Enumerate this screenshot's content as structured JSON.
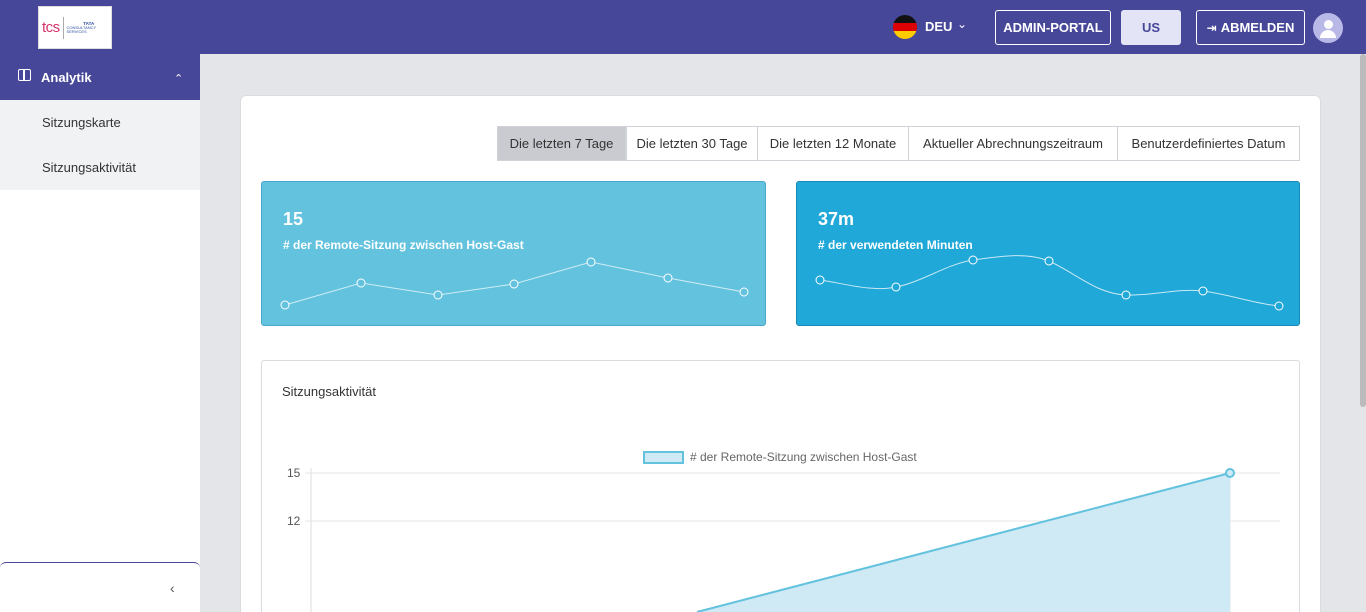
{
  "header": {
    "logo_brand": "tcs",
    "logo_tata": "TATA",
    "logo_consultancy": "CONSULTANCY SERVICES",
    "language": "DEU",
    "admin_portal_label": "ADMIN-PORTAL",
    "region_label": "US",
    "logout_label": "ABMELDEN"
  },
  "sidebar": {
    "section_label": "Analytik",
    "items": [
      {
        "label": "Sitzungskarte"
      },
      {
        "label": "Sitzungsaktivität"
      }
    ]
  },
  "filters": {
    "selected": "Die letzten 7 Tage",
    "options": [
      "Die letzten 7 Tage",
      "Die letzten 30 Tage",
      "Die letzten 12 Monate",
      "Aktueller Abrechnungszeitraum",
      "Benutzerdefiniertes Datum"
    ]
  },
  "tiles": [
    {
      "value": "15",
      "label": "# der Remote-Sitzung zwischen Host-Gast",
      "color": "#63c2de",
      "sparkline": [
        1,
        3,
        2,
        3,
        5,
        3.5,
        2
      ],
      "smooth": false
    },
    {
      "value": "37m",
      "label": "# der verwendeten Minuten",
      "color": "#20a8d8",
      "sparkline": [
        3,
        2.5,
        5,
        5,
        1,
        1.5,
        0
      ],
      "smooth": true
    }
  ],
  "activity_chart": {
    "title": "Sitzungsaktivität",
    "legend": "# der Remote-Sitzung zwischen Host-Gast",
    "line_color": "#63c2de",
    "fill_color": "#cfeaf5",
    "chart_data": {
      "type": "area",
      "series": [
        {
          "name": "# der Remote-Sitzung zwischen Host-Gast",
          "values": [
            0,
            0,
            0,
            0,
            15
          ]
        }
      ],
      "y_ticks_visible": [
        "15",
        "12"
      ],
      "ylim": [
        0,
        15
      ]
    }
  }
}
